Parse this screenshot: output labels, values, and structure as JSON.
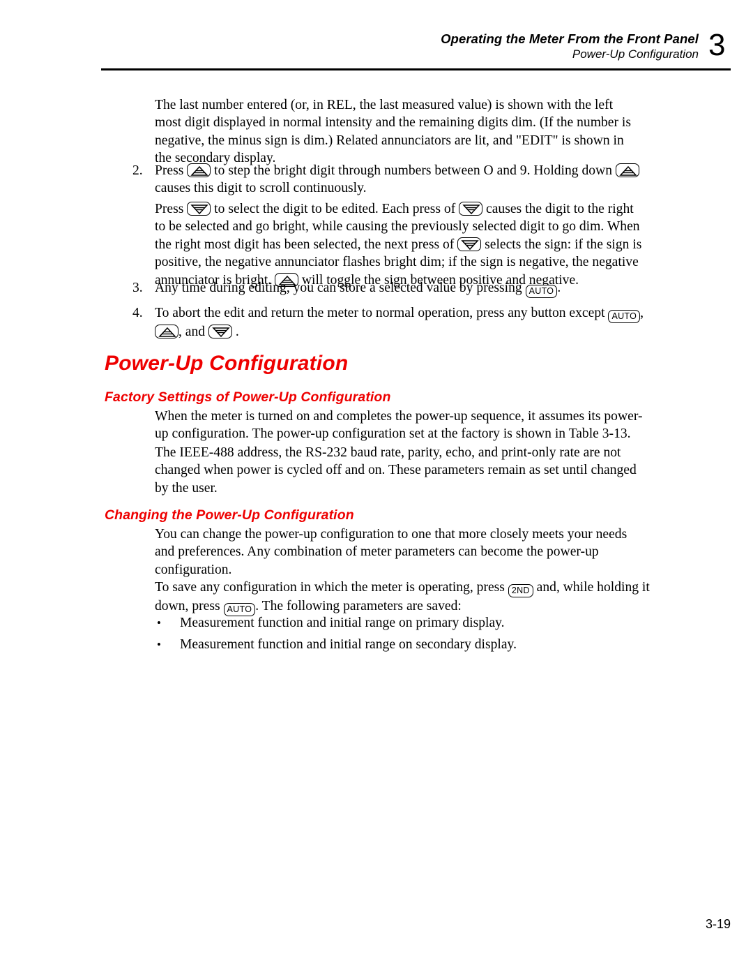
{
  "header": {
    "title": "Operating the Meter From the Front Panel",
    "subtitle": "Power-Up Configuration",
    "chapter_number": "3",
    "rule_color": "#000000"
  },
  "footer": {
    "page_number": "3-19"
  },
  "colors": {
    "heading_red": "#ee0000",
    "text_black": "#000000"
  },
  "icons": {
    "auto_label": "AUTO",
    "second_label": "2ND",
    "up_arrow_name": "up-arrow-key-icon",
    "down_arrow_name": "down-arrow-key-icon"
  },
  "content": {
    "intro_paragraph": {
      "part1": "The last number entered (or, in REL, the last measured value) is shown with the left most digit displayed in normal intensity and the remaining digits dim. (If the number is negative, the minus sign is dim.) Related annunciators are lit, and \"EDIT\" is shown in the secondary display."
    },
    "step2": {
      "number": "2.",
      "t1": "Press ",
      "t2": " to step the bright digit through numbers between O and 9. Holding down ",
      "t3": " causes this digit to scroll continuously."
    },
    "step2b": {
      "t1": "Press ",
      "t2": " to select the digit to be edited. Each press of ",
      "t3": " causes the digit to the right to be selected and go bright, while causing the previously selected digit to go dim. When the right most digit has been selected, the next press of ",
      "t4": " selects the sign: if the sign is positive, the negative annunciator flashes bright dim; if the sign is negative, the negative annunciator is bright. ",
      "t5": " will toggle the sign between positive and negative."
    },
    "step3": {
      "number": "3.",
      "t1": "Any time during editing, you can store a selected value by pressing ",
      "t2": "."
    },
    "step4": {
      "number": "4.",
      "t1": "To abort the edit and return the meter to normal operation, press any button except ",
      "t2": ", ",
      "t3": ", and ",
      "t4": " ."
    },
    "heading_powerup": "Power-Up Configuration",
    "heading_factory": "Factory Settings of Power-Up Configuration",
    "factory_p1": "When the meter is turned on and completes the power-up sequence, it assumes its power-up configuration. The power-up configuration set at the factory is shown in Table 3-13.",
    "factory_p2": "The IEEE-488 address, the RS-232 baud rate, parity, echo, and print-only rate are not changed when power is cycled off and on. These parameters remain as set until changed by the user.",
    "heading_changing": "Changing the Power-Up Configuration",
    "changing_p1": "You can change the power-up configuration to one that more closely meets your needs and preferences. Any combination of meter parameters can become the power-up configuration.",
    "changing_p2": {
      "t1": "To save any configuration in which the meter is operating, press ",
      "t2": " and, while holding it down, press ",
      "t3": ". The following parameters are saved:"
    },
    "bullets": [
      {
        "marker": "•",
        "text": "Measurement function and initial range on primary display."
      },
      {
        "marker": "•",
        "text": "Measurement function and initial range on secondary display."
      }
    ]
  }
}
